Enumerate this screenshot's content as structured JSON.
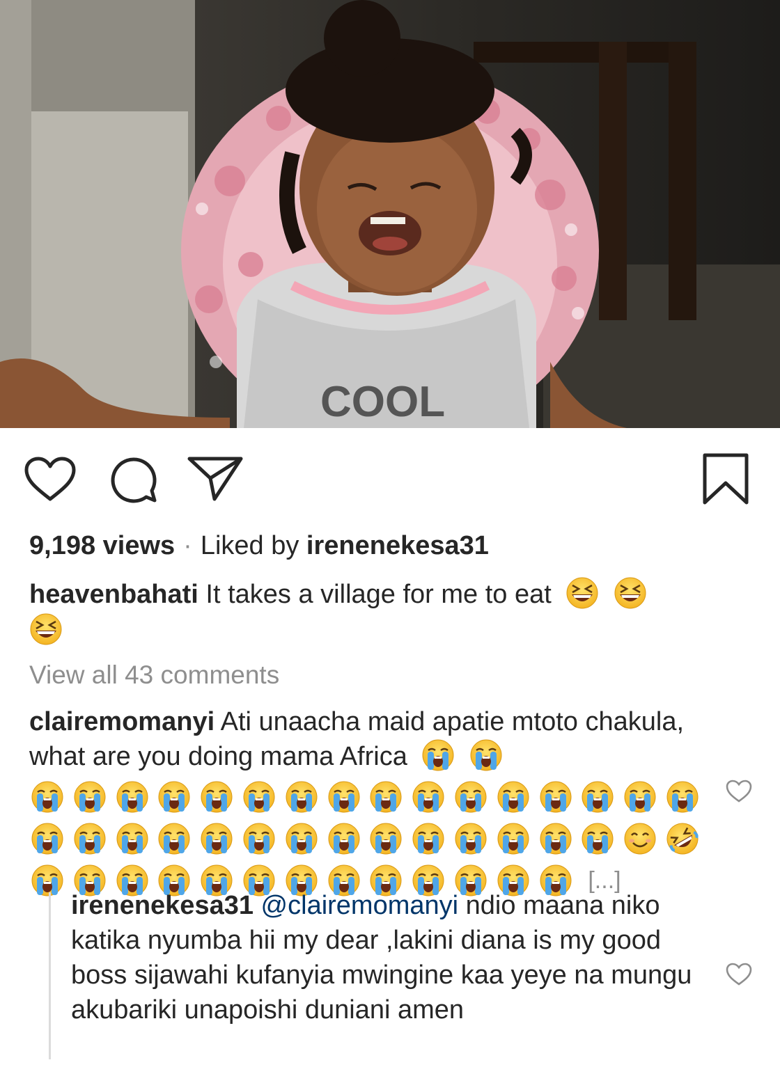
{
  "post": {
    "photo_alt": "toddler in pink high chair",
    "shirt_text": "COOL"
  },
  "actions": {
    "like_icon": "heart-outline-icon",
    "comment_icon": "comment-bubble-icon",
    "share_icon": "paper-plane-icon",
    "save_icon": "bookmark-icon"
  },
  "stats": {
    "views": "9,198 views",
    "separator": "·",
    "liked_by_prefix": "Liked by ",
    "liked_by_user": "irenenekesa31"
  },
  "caption": {
    "username": "heavenbahati",
    "text": " It takes a village for me to eat",
    "emojis": [
      "grinning-squinting-face",
      "grinning-squinting-face",
      "grinning-squinting-face"
    ]
  },
  "view_all_comments": "View all 43 comments",
  "comments": [
    {
      "username": "clairemomanyi",
      "text": " Ati unaacha maid apatie mtoto chakula, what are you doing mama Africa",
      "inline_emojis": [
        "loudly-crying-face",
        "loudly-crying-face"
      ],
      "emoji_rows": [
        [
          "cry",
          "cry",
          "cry",
          "cry",
          "cry",
          "cry",
          "cry",
          "cry",
          "cry",
          "cry",
          "cry",
          "cry",
          "cry",
          "cry",
          "cry",
          "cry"
        ],
        [
          "cry",
          "cry",
          "cry",
          "cry",
          "cry",
          "cry",
          "cry",
          "cry",
          "cry",
          "cry",
          "cry",
          "cry",
          "cry",
          "cry",
          "smile",
          "rofl"
        ],
        [
          "cry",
          "cry",
          "cry",
          "cry",
          "cry",
          "cry",
          "cry",
          "cry",
          "cry",
          "cry",
          "cry",
          "cry",
          "cry"
        ]
      ],
      "truncation": "[...]"
    }
  ],
  "reply": {
    "username": "irenenekesa31",
    "mention": "@clairemomanyi",
    "text": " ndio maana niko katika nyumba hii my dear ,lakini diana is my good boss sijawahi kufanyia mwingine kaa yeye na mungu akubariki unapoishi duniani amen"
  },
  "colors": {
    "text": "#262626",
    "muted": "#8e8e8e",
    "mention": "#003569",
    "emoji_yellow": "#f7c12b",
    "tear_blue": "#4fa6e8"
  }
}
